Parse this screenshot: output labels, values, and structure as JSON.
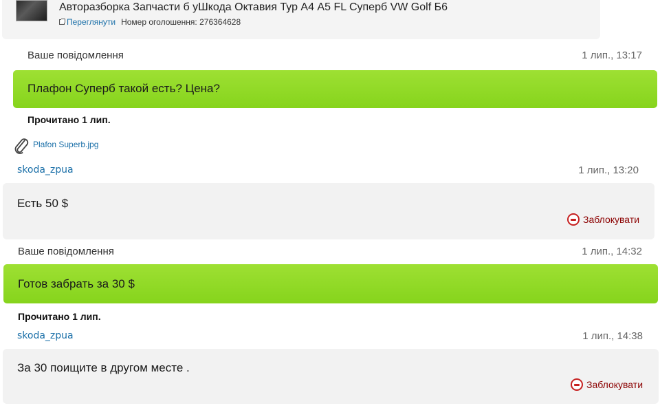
{
  "ad": {
    "title": "Авторазборка Запчасти б уШкода Октавия Тур А4 А5 FL Суперб VW Golf Б6",
    "view_link": "Переглянути",
    "ad_number_label": "Номер оголошення: 276364628"
  },
  "messages": [
    {
      "sender": "Ваше повідомлення",
      "time": "1 лип., 13:17",
      "text": "Плафон Суперб такой есть? Цена?",
      "read": "Прочитано 1 лип.",
      "attachment": "Plafon Superb.jpg"
    },
    {
      "sender": "skoda_zpua",
      "time": "1 лип., 13:20",
      "text": "Есть 50 $",
      "block_label": "Заблокувати"
    },
    {
      "sender": "Ваше повідомлення",
      "time": "1 лип., 14:32",
      "text": "Готов забрать за 30 $",
      "read": "Прочитано 1 лип."
    },
    {
      "sender": "skoda_zpua",
      "time": "1 лип., 14:38",
      "text": "За 30 поищите в другом месте .",
      "block_label": "Заблокувати"
    }
  ],
  "icons": {
    "attachment": "paperclip-icon",
    "block": "block-circle-icon",
    "external_link": "external-link-icon"
  },
  "colors": {
    "own_message_bg": "#8fd826",
    "other_message_bg": "#f2f2f2",
    "link": "#1a6fa8",
    "block": "#c62020"
  }
}
